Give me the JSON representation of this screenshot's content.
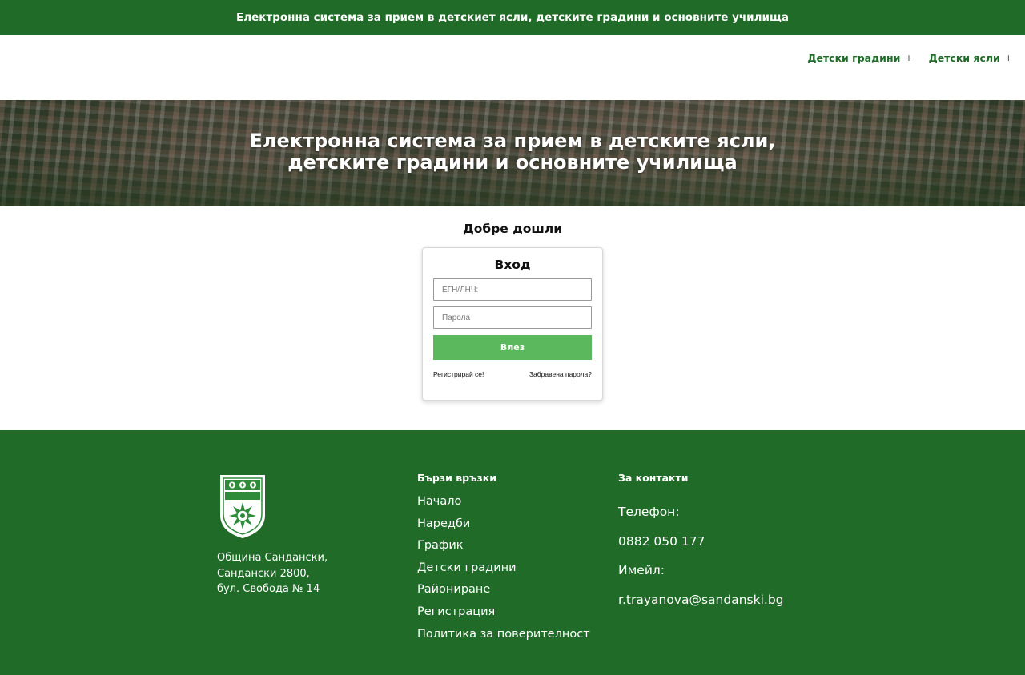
{
  "banner": {
    "text": "Електронна система за прием в детскиет ясли, детските градини и основните училища"
  },
  "nav": {
    "items": [
      {
        "label": "Детски градини",
        "expander": "+"
      },
      {
        "label": "Детски ясли",
        "expander": "+"
      }
    ]
  },
  "hero": {
    "title": "Електронна система за прием в детските ясли, детските градини и основните училища"
  },
  "welcome": {
    "text": "Добре дошли"
  },
  "login": {
    "title": "Вход",
    "id_placeholder": "ЕГН/ЛНЧ:",
    "id_value": "",
    "password_placeholder": "Парола",
    "password_value": "",
    "submit_label": "Влез",
    "register_link": "Регистрирай се!",
    "forgot_link": "Забравена парола?"
  },
  "footer": {
    "logo_text": "Сандански",
    "address": [
      "Община Сандански,",
      "Сандански 2800,",
      "бул. Свобода № 14"
    ],
    "quick_links": {
      "title": "Бързи връзки",
      "items": [
        "Начало",
        "Наредби",
        "График",
        "Детски градини",
        "Райониране",
        "Регистрация",
        "Политика за поверителност"
      ]
    },
    "contacts": {
      "title": "За контакти",
      "phone_label": "Телефон:",
      "phone": "0882 050 177",
      "email_label": "Имейл:",
      "email": "r.trayanova@sandanski.bg"
    }
  },
  "colors": {
    "brand_green": "#1f6b27",
    "button_green": "#5cb85c"
  },
  "icons": {
    "nav_expander": "plus-icon",
    "logo": "sandanski-coat-of-arms-icon"
  }
}
